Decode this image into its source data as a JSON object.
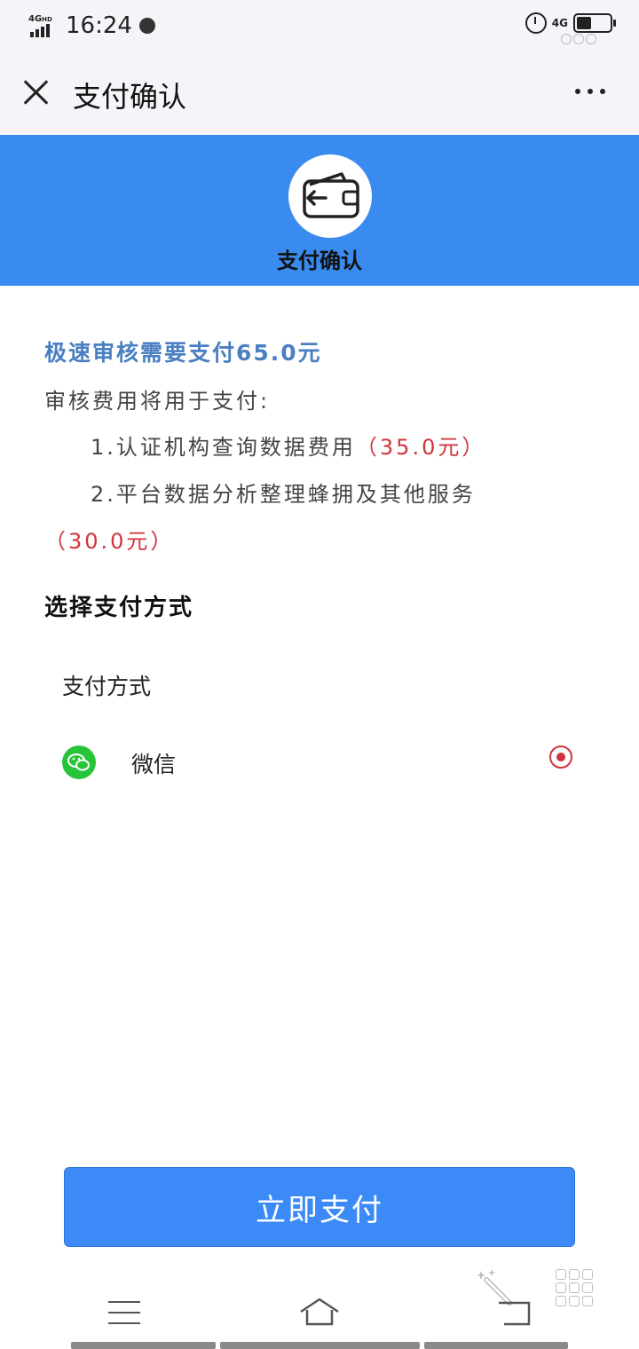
{
  "status_bar": {
    "network_left": "4G",
    "network_left_suffix": "HD",
    "time": "16:24",
    "network_right": "4G",
    "battery_level": 0.45
  },
  "nav": {
    "title": "支付确认"
  },
  "banner": {
    "title": "支付确认"
  },
  "content": {
    "headline": "极速审核需要支付65.0元",
    "intro": "审核费用将用于支付:",
    "item1_text": "1.认证机构查询数据费用",
    "item1_amount": "（35.0元）",
    "item2_text": "2.平台数据分析整理蜂拥及其他服务",
    "item2_amount": "（30.0元）"
  },
  "payment": {
    "section_title": "选择支付方式",
    "method_label": "支付方式",
    "options": [
      {
        "label": "微信",
        "selected": true
      }
    ]
  },
  "action": {
    "pay_button": "立即支付"
  },
  "colors": {
    "banner_blue": "#3a8bef",
    "headline_blue": "#4a7fc1",
    "amount_red": "#d0333d",
    "button_blue": "#3b8af7",
    "wechat_green": "#27c43a"
  }
}
